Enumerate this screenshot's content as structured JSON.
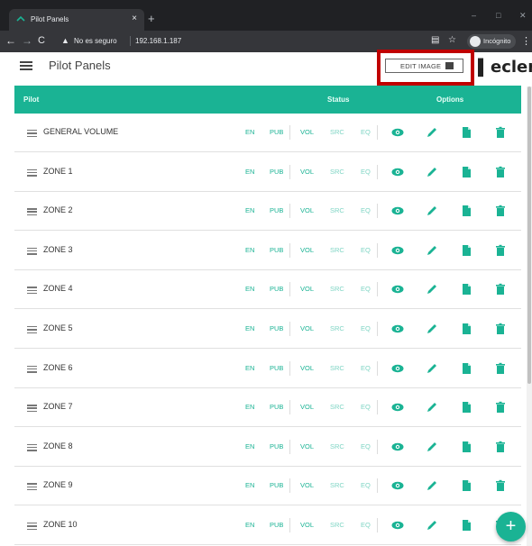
{
  "browser": {
    "tab_title": "Pilot Panels",
    "tab_close": "×",
    "new_tab": "+",
    "security_label": "No es seguro",
    "url": "192.168.1.187",
    "incognito_label": "Incógnito",
    "minimize": "–",
    "maximize": "□",
    "close": "✕"
  },
  "app": {
    "title": "Pilot Panels",
    "edit_image_label": "EDIT IMAGE",
    "logo_text": "ecler",
    "accent_color": "#1ab394",
    "highlight_color": "#c00000"
  },
  "table": {
    "headers": {
      "pilot": "Pilot",
      "status": "Status",
      "options": "Options"
    },
    "status_labels": [
      "EN",
      "PUB",
      "VOL",
      "SRC",
      "EQ"
    ],
    "rows": [
      {
        "name": "GENERAL VOLUME"
      },
      {
        "name": "ZONE 1"
      },
      {
        "name": "ZONE 2"
      },
      {
        "name": "ZONE 3"
      },
      {
        "name": "ZONE 4"
      },
      {
        "name": "ZONE 5"
      },
      {
        "name": "ZONE 6"
      },
      {
        "name": "ZONE 7"
      },
      {
        "name": "ZONE 8"
      },
      {
        "name": "ZONE 9"
      },
      {
        "name": "ZONE 10"
      }
    ],
    "option_icons": [
      "eye-icon",
      "pencil-icon",
      "copy-icon",
      "trash-icon"
    ]
  },
  "fab": {
    "label": "+"
  }
}
